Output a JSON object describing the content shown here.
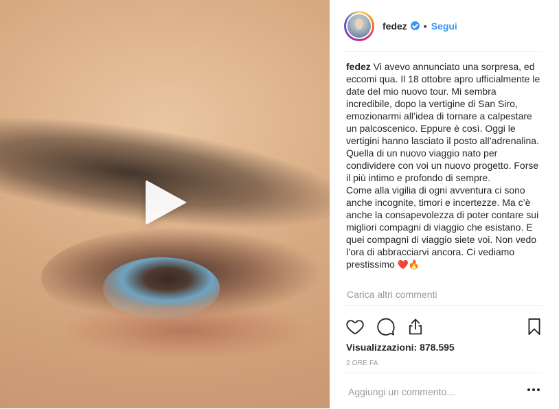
{
  "post": {
    "username": "fedez",
    "dot": "•",
    "follow_label": "Segui",
    "caption_username": "fedez",
    "caption_text": " Vi avevo annunciato una sorpresa, ed eccomi qua. Il 18 ottobre apro ufficialmente le date del mio nuovo tour. Mi sembra incredibile, dopo la vertigine di San Siro, emozionarmi all’idea di tornare a calpestare un palcoscenico. Eppure è così. Oggi le vertigini hanno lasciato il posto all’adrenalina. Quella di un nuovo viaggio nato per condividere con voi un nuovo progetto. Forse il più intimo e profondo di sempre.\nCome alla vigilia di ogni avventura ci sono anche incognite, timori e incertezze. Ma c’è anche la consapevolezza di poter contare sui migliori compagni di viaggio che esistano. E quei compagni di viaggio siete voi. Non vedo l’ora di abbracciarvi ancora. Ci vediamo prestissimo ",
    "caption_emoji": "❤️🔥",
    "load_more_label": "Carica altri commenti",
    "views_label": "Visualizzazioni:",
    "views_count": "878.595",
    "time_ago": "2 ORE FA",
    "comment_placeholder": "Aggiungi un commento..."
  },
  "icons": {
    "like": "heart-icon",
    "comment": "comment-icon",
    "share": "share-icon",
    "save": "bookmark-icon",
    "play": "play-icon",
    "more": "more-options-icon",
    "verified": "verified-badge-icon"
  },
  "colors": {
    "link_blue": "#3897f0",
    "text": "#262626",
    "muted": "#999999",
    "border": "#efefef"
  }
}
